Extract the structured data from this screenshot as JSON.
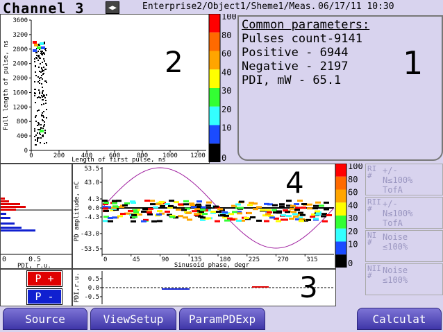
{
  "header": {
    "channel": "Channel 3",
    "path": "Enterprise2/Object1/Sheme1/Meas.",
    "datetime": "06/17/11 10:30"
  },
  "panel1": {
    "number": "1",
    "title": "Common parameters:",
    "lines": [
      "Pulses count-9141",
      "Positive - 6944",
      "Negative - 2197",
      "PDI, mW -  65.1"
    ]
  },
  "panel2": {
    "number": "2",
    "ylabel": "Full length of pulse, ns",
    "xlabel": "Length of first pulse, ns",
    "yticks": [
      "3600",
      "3200",
      "2800",
      "2400",
      "2000",
      "1600",
      "1200",
      "800",
      "400",
      "0"
    ],
    "xticks": [
      "0",
      "200",
      "400",
      "600",
      "800",
      "1000",
      "1200"
    ]
  },
  "scale1": {
    "labels": [
      "100",
      "80",
      "60",
      "40",
      "30",
      "20",
      "10",
      "0"
    ]
  },
  "panel4": {
    "number": "4",
    "ylabel": "PD amplitude, nC",
    "xlabel": "Sinusoid phase, degr",
    "yticks": [
      "53.5",
      "43.0",
      "4.3",
      "0.0",
      "-4.3",
      "-43.0",
      "-53.5"
    ],
    "xticks": [
      "0",
      "45",
      "90",
      "135",
      "180",
      "225",
      "270",
      "315"
    ]
  },
  "scale2": {
    "labels": [
      "100",
      "80",
      "60",
      "40",
      "30",
      "20",
      "10",
      "0"
    ]
  },
  "pdi_hist": {
    "xlabel": "PDI, r.u.",
    "ticks": [
      "0",
      "0.5"
    ]
  },
  "legend": {
    "plus": "P +",
    "minus": "P -"
  },
  "panel3": {
    "number": "3",
    "ylabel": "PDI,r.u.",
    "yticks": [
      "0.5",
      "0.0",
      "-0.5"
    ]
  },
  "side_channels": [
    {
      "id": "RI",
      "sub": "#",
      "lines": [
        "+/-",
        "N≤100%",
        "TofA"
      ]
    },
    {
      "id": "RII",
      "sub": "#",
      "lines": [
        "+/-",
        "N≤100%",
        "TofA"
      ]
    },
    {
      "id": "NI",
      "sub": "#",
      "lines": [
        "Noise",
        "≤100%",
        ""
      ]
    },
    {
      "id": "NII",
      "sub": "#",
      "lines": [
        "Noise",
        "≤100%",
        ""
      ]
    }
  ],
  "buttons": {
    "source": "Source",
    "viewsetup": "ViewSetup",
    "parampdexp": "ParamPDExp",
    "calculat": "Calculat"
  },
  "colors": {
    "scale": [
      "#ff0000",
      "#ff6a00",
      "#ffa500",
      "#ffff00",
      "#33ff33",
      "#33ffff",
      "#1b4bff",
      "#000000"
    ],
    "sine": "#a020a0",
    "positive": "#e00000",
    "negative": "#1020d0"
  }
}
